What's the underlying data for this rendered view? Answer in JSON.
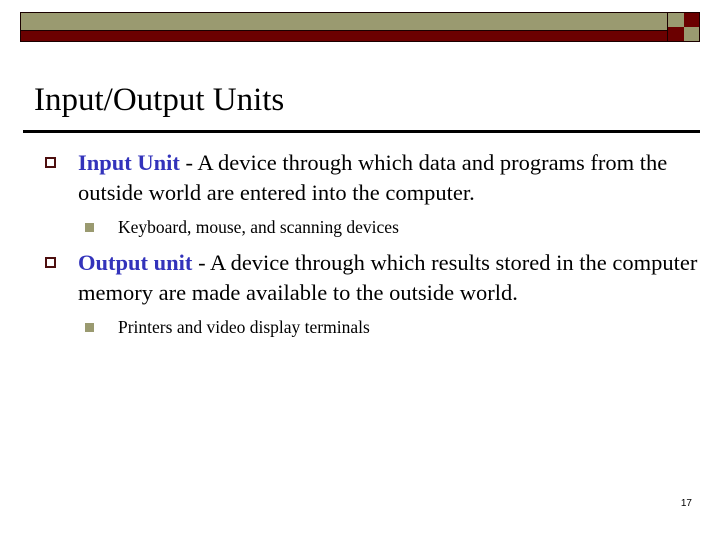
{
  "slide": {
    "title": "Input/Output Units",
    "slide_number": "17",
    "colors": {
      "banner_khaki": "#9a9a70",
      "banner_maroon": "#6b0000",
      "bullet_marker": "#4d0f0f",
      "subbullet_marker": "#9a9a70",
      "lead_text": "#3333bb",
      "body_text": "#000000"
    },
    "banner": {
      "checker": [
        "khaki",
        "maroon",
        "maroon",
        "khaki"
      ]
    },
    "bullets": [
      {
        "marker": "hollow-square-bullet",
        "lead": "Input Unit",
        "rest": " - A device through which data and programs from the outside world are entered into the computer.",
        "sub": {
          "marker": "filled-square-bullet",
          "text": "Keyboard, mouse, and scanning devices"
        }
      },
      {
        "marker": "hollow-square-bullet",
        "lead": "Output unit",
        "rest": " - A device through which results stored in the computer memory are made available to the outside world.",
        "sub": {
          "marker": "filled-square-bullet",
          "text": "Printers and video display terminals"
        }
      }
    ]
  }
}
